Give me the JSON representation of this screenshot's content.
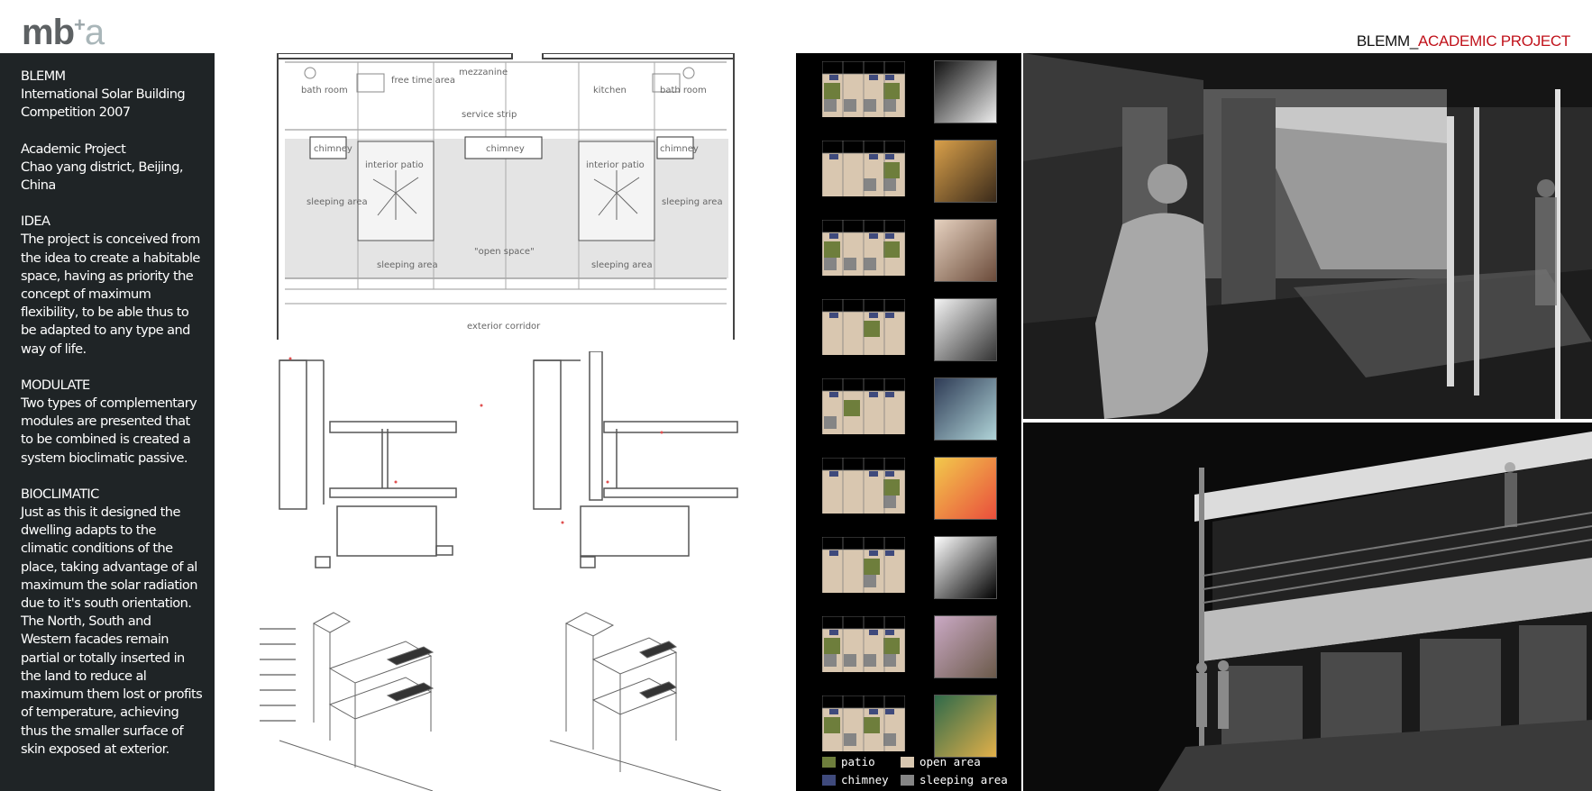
{
  "header": {
    "logo": {
      "main": "mb",
      "plus": "+",
      "suffix": "a"
    },
    "title_part1": "BLEMM_",
    "title_part2": "ACADEMIC PROJECT"
  },
  "sidebar": {
    "intro_lines": [
      "BLEMM",
      "International Solar Building",
      "Competition 2007"
    ],
    "location_lines": [
      "Academic Project",
      "Chao yang district, Beijing,",
      "China"
    ],
    "idea_heading": "IDEA",
    "idea_lines": [
      "The project is conceived from",
      "the idea to create a habitable",
      "space, having as priority the",
      "concept of maximum",
      "flexibility, to be able thus to",
      "be adapted to any type and",
      "way of life."
    ],
    "modulate_heading": "MODULATE",
    "modulate_lines": [
      "Two types of complementary",
      "modules are presented that",
      "to be combined is created a",
      "system bioclimatic passive."
    ],
    "bioclimatic_heading": "BIOCLIMATIC",
    "bioclimatic_lines": [
      "Just as this it designed the",
      "dwelling adapts to the",
      "climatic conditions of the",
      "place, taking advantage of al",
      "maximum the solar radiation",
      "due to it's south orientation.",
      "The North, South and",
      "Western facades remain",
      "partial or totally inserted in",
      "the land to reduce al",
      "maximum them lost or profits",
      "of temperature, achieving",
      "thus the smaller surface of",
      "skin exposed at exterior."
    ]
  },
  "plan": {
    "labels": {
      "bath_left": "bath room",
      "free_time": "free time area",
      "mezzanine": "mezzanine",
      "kitchen": "kitchen",
      "bath_right": "bath room",
      "service_strip": "service strip",
      "chimney1": "chimney",
      "chimney2": "chimney",
      "chimney3": "chimney",
      "patio_left": "interior patio",
      "patio_right": "interior patio",
      "sleeping1": "sleeping area",
      "sleeping2": "sleeping area",
      "sleeping3": "sleeping area",
      "sleeping4": "sleeping area",
      "open_space": "\"open space\"",
      "corridor": "exterior corridor"
    }
  },
  "modules": {
    "rows": [
      {
        "thumb": "dancers-photo"
      },
      {
        "thumb": "musicians-painting"
      },
      {
        "thumb": "family-sepia-photo"
      },
      {
        "thumb": "victorian-couple-engraving"
      },
      {
        "thumb": "ballerina-painting"
      },
      {
        "thumb": "colorful-street-art"
      },
      {
        "thumb": "piano-silhouette"
      },
      {
        "thumb": "salon-painting"
      },
      {
        "thumb": "portrait-painting"
      }
    ],
    "colors": {
      "patio": "#6e7e3c",
      "chimney": "#3f4a7c",
      "open": "#d9c7b0",
      "sleeping": "#858585"
    },
    "legend": {
      "patio": "patio",
      "chimney": "chimney",
      "open": "open area",
      "sleeping": "sleeping area"
    }
  },
  "colors": {
    "sidebar_bg": "#1f2426",
    "accent_red": "#c0121b"
  }
}
